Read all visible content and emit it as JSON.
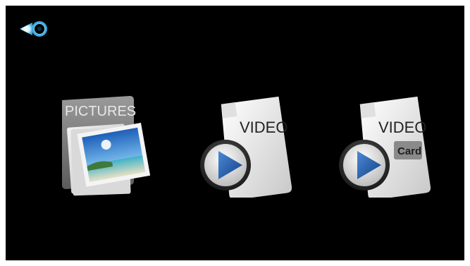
{
  "back_button": {
    "icon": "back-arrow-icon"
  },
  "tiles": [
    {
      "id": "pictures",
      "label": "PICTURES",
      "icon": "pictures-folder-icon"
    },
    {
      "id": "video",
      "label": "VIDEO",
      "icon": "video-file-icon"
    },
    {
      "id": "video-card",
      "label": "VIDEO",
      "badge": "Card",
      "icon": "video-card-file-icon"
    }
  ],
  "colors": {
    "background": "#000000",
    "frame": "#ffffff",
    "play_blue": "#1f5fb0",
    "back_glow": "#7fd6ff"
  }
}
